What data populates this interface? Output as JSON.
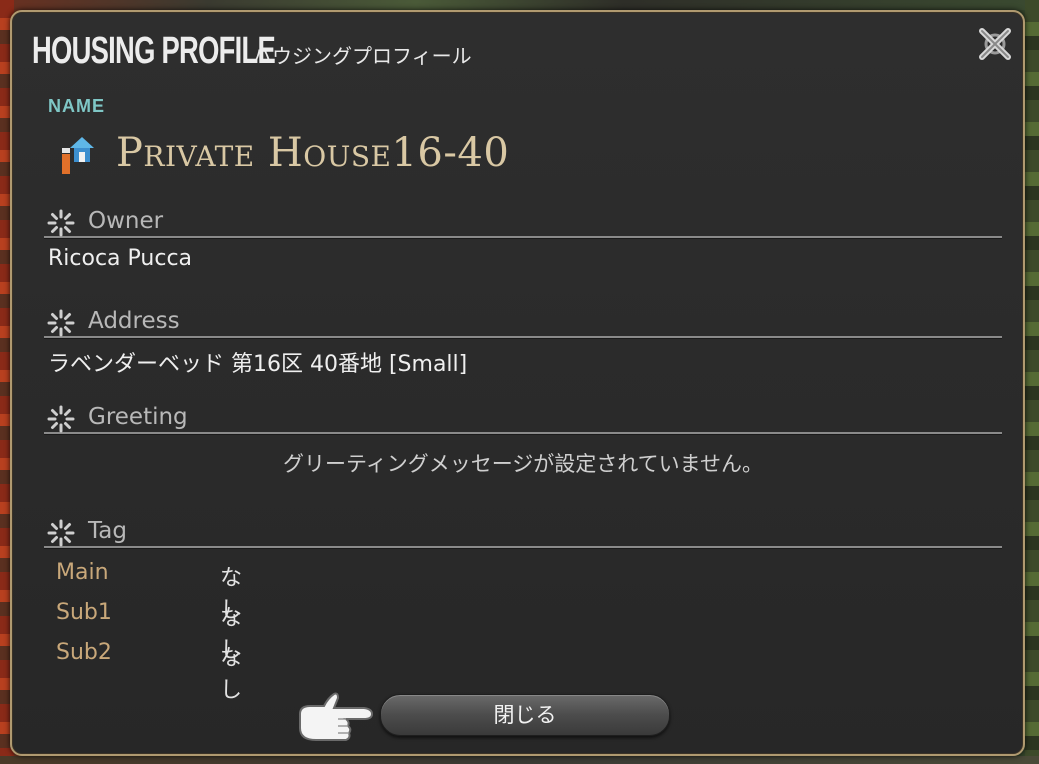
{
  "window": {
    "title_en": "HOUSING PROFILE",
    "title_jp": "ハウジングプロフィール",
    "close_icon": "close-x-icon"
  },
  "name_section": {
    "label": "NAME",
    "icon": "house-icon",
    "house_name": "Private House16-40"
  },
  "owner": {
    "label": "Owner",
    "value": "Ricoca Pucca"
  },
  "address": {
    "label": "Address",
    "value": "ラベンダーベッド 第16区 40番地 [Small]"
  },
  "greeting": {
    "label": "Greeting",
    "value": "グリーティングメッセージが設定されていません。"
  },
  "tag": {
    "label": "Tag",
    "rows": [
      {
        "key": "Main",
        "value": "なし"
      },
      {
        "key": "Sub1",
        "value": "なし"
      },
      {
        "key": "Sub2",
        "value": "なし"
      }
    ]
  },
  "footer": {
    "close_button_label": "閉じる",
    "pointer_icon": "pointing-hand-icon"
  },
  "colors": {
    "accent_label": "#7fc7c6",
    "house_name": "#d9c8a4",
    "tag_key": "#c9a87a",
    "border_gold": "#b09a70"
  }
}
